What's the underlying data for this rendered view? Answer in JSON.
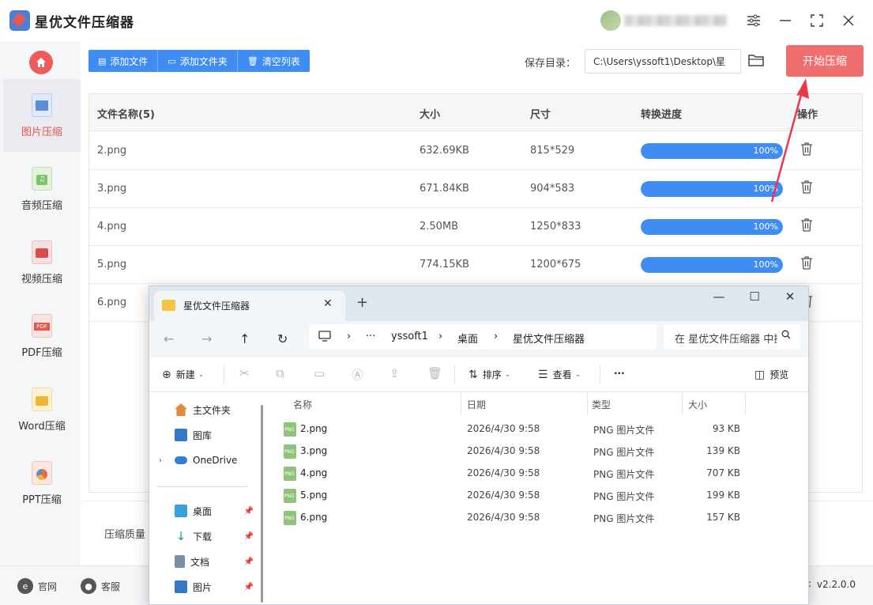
{
  "app": {
    "title": "星优文件压缩器",
    "window_controls": [
      "≡",
      "—",
      "☐",
      "✕"
    ]
  },
  "sidebar": {
    "items": [
      {
        "label": "图片压缩",
        "active": true,
        "icon": "image-compress-icon",
        "color": "#5a8fd6"
      },
      {
        "label": "音频压缩",
        "active": false,
        "icon": "audio-compress-icon",
        "color": "#7bc46b"
      },
      {
        "label": "视频压缩",
        "active": false,
        "icon": "video-compress-icon",
        "color": "#d94c4c"
      },
      {
        "label": "PDF压缩",
        "active": false,
        "icon": "pdf-compress-icon",
        "color": "#e0584f"
      },
      {
        "label": "Word压缩",
        "active": false,
        "icon": "word-compress-icon",
        "color": "#f2b530"
      },
      {
        "label": "PPT压缩",
        "active": false,
        "icon": "ppt-compress-icon",
        "color": "#e56b4b"
      }
    ]
  },
  "toolbar": {
    "add_file": "添加文件",
    "add_folder": "添加文件夹",
    "clear_list": "清空列表",
    "save_dir_label": "保存目录：",
    "save_dir_value": "C:\\Users\\yssoft1\\Desktop\\星",
    "start_button": "开始压缩"
  },
  "table": {
    "headers": {
      "name": "文件名称(5)",
      "size": "大小",
      "dimension": "尺寸",
      "progress": "转换进度",
      "action": "操作"
    },
    "rows": [
      {
        "name": "2.png",
        "size": "632.69KB",
        "dimension": "815*529",
        "progress": "100%",
        "progress_value": 1.0
      },
      {
        "name": "3.png",
        "size": "671.84KB",
        "dimension": "904*583",
        "progress": "100%",
        "progress_value": 1.0
      },
      {
        "name": "4.png",
        "size": "2.50MB",
        "dimension": "1250*833",
        "progress": "100%",
        "progress_value": 1.0
      },
      {
        "name": "5.png",
        "size": "774.15KB",
        "dimension": "1200*675",
        "progress": "100%",
        "progress_value": 1.0
      },
      {
        "name": "6.png",
        "size": "",
        "dimension": "",
        "progress": "",
        "progress_value": null
      }
    ]
  },
  "bottom": {
    "quality_label": "压缩质量"
  },
  "status": {
    "website": "官网",
    "support": "客服",
    "version_colon": ":",
    "version": "v2.2.0.0"
  },
  "explorer": {
    "tab_title": "星优文件压缩器",
    "tab_close": "✕",
    "new_tab": "+",
    "controls": [
      "—",
      "☐",
      "✕"
    ],
    "nav": {
      "back": "←",
      "forward": "→",
      "up": "↑",
      "refresh": "↻"
    },
    "address": {
      "more": "···",
      "parts": [
        "yssoft1",
        "桌面",
        "星优文件压缩器"
      ]
    },
    "search_placeholder": "在 星优文件压缩器 中搜索",
    "commands": {
      "new": "新建",
      "sort": "排序",
      "view": "查看",
      "more": "···",
      "preview": "预览"
    },
    "nav_pane": [
      {
        "label": "主文件夹",
        "icon": "home-icon",
        "pinned": false
      },
      {
        "label": "图库",
        "icon": "gallery-icon",
        "pinned": false
      },
      {
        "label": "OneDrive",
        "icon": "onedrive-icon",
        "pinned": false
      },
      {
        "label": "桌面",
        "icon": "desktop-icon",
        "pinned": true
      },
      {
        "label": "下载",
        "icon": "download-icon",
        "pinned": true
      },
      {
        "label": "文档",
        "icon": "documents-icon",
        "pinned": true
      },
      {
        "label": "图片",
        "icon": "pictures-icon",
        "pinned": true
      }
    ],
    "columns": {
      "name": "名称",
      "date": "日期",
      "type": "类型",
      "size": "大小"
    },
    "files": [
      {
        "name": "2.png",
        "date": "2026/4/30 9:58",
        "type": "PNG 图片文件",
        "size": "93 KB"
      },
      {
        "name": "3.png",
        "date": "2026/4/30 9:58",
        "type": "PNG 图片文件",
        "size": "139 KB"
      },
      {
        "name": "4.png",
        "date": "2026/4/30 9:58",
        "type": "PNG 图片文件",
        "size": "707 KB"
      },
      {
        "name": "5.png",
        "date": "2026/4/30 9:58",
        "type": "PNG 图片文件",
        "size": "199 KB"
      },
      {
        "name": "6.png",
        "date": "2026/4/30 9:58",
        "type": "PNG 图片文件",
        "size": "157 KB"
      }
    ]
  },
  "colors": {
    "accent_blue": "#3f8df2",
    "start_red": "#f16e6e",
    "active_red": "#e8564f",
    "annotation_arrow": "#e8394a"
  }
}
